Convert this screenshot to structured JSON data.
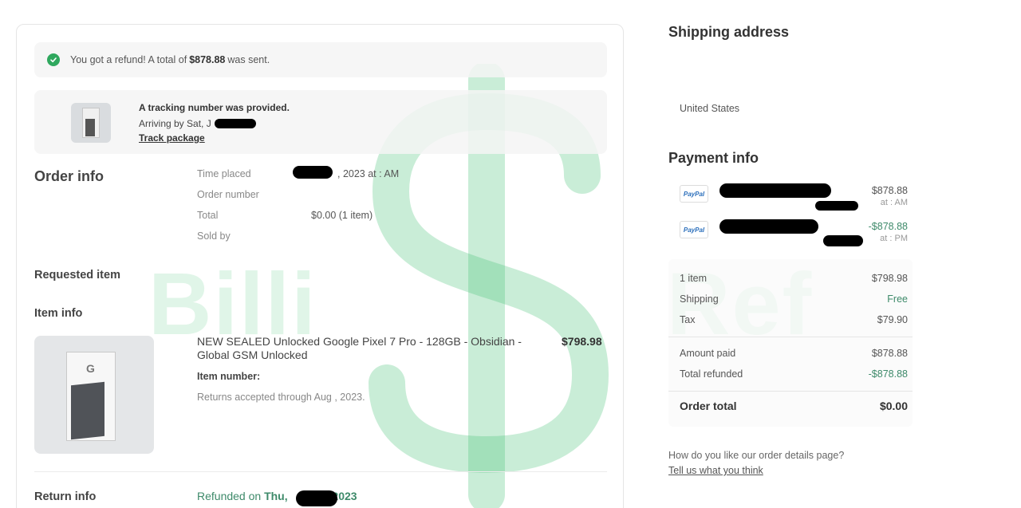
{
  "refund_banner": {
    "prefix": "You got a refund! A total of",
    "amount": "$878.88",
    "suffix": "was sent."
  },
  "tracking": {
    "title": "A tracking number was provided.",
    "arrival": "Arriving by Sat, J",
    "link": "Track package"
  },
  "order_info": {
    "title": "Order info",
    "rows": [
      {
        "label": "Time placed",
        "value": ", 2023 at  :  AM"
      },
      {
        "label": "Order number",
        "value": ""
      },
      {
        "label": "Total",
        "value": "$0.00 (1 item)"
      },
      {
        "label": "Sold by",
        "value": ""
      }
    ]
  },
  "requested_item": {
    "title": "Requested item"
  },
  "item_info": {
    "title": "Item info",
    "name": "NEW SEALED Unlocked Google Pixel 7 Pro - 128GB - Obsidian - Global GSM Unlocked",
    "price": "$798.98",
    "item_number_label": "Item number:",
    "item_number_value": "",
    "returns": "Returns accepted through Aug  , 2023."
  },
  "return_info": {
    "title": "Return info",
    "refunded_prefix": "Refunded on",
    "refunded_day": "Thu,",
    "refunded_year": "2023"
  },
  "shipping": {
    "title": "Shipping address",
    "country": "United States"
  },
  "payment": {
    "title": "Payment info",
    "method_label": "PayPal",
    "transactions": [
      {
        "amount": "$878.88",
        "time": "at  : AM",
        "negative": false
      },
      {
        "amount": "-$878.88",
        "time": "at  :  PM",
        "negative": true
      }
    ]
  },
  "summary": {
    "rows": [
      {
        "label": "1 item",
        "value": "$798.98",
        "green": false
      },
      {
        "label": "Shipping",
        "value": "Free",
        "green": true
      },
      {
        "label": "Tax",
        "value": "$79.90",
        "green": false
      }
    ],
    "paid_rows": [
      {
        "label": "Amount paid",
        "value": "$878.88",
        "green": false
      },
      {
        "label": "Total refunded",
        "value": "-$878.88",
        "green": true
      }
    ],
    "total_label": "Order total",
    "total_value": "$0.00"
  },
  "feedback": {
    "question": "How do you like our order details page?",
    "link": "Tell us what you think"
  },
  "watermark": {
    "left_text": "Billi",
    "right_text": "Ref",
    "color": "#3cbe6e"
  }
}
